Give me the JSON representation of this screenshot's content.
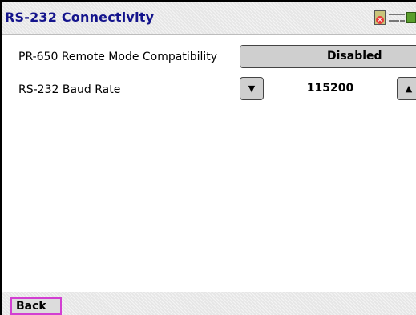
{
  "header": {
    "title": "RS-232 Connectivity",
    "status_icons": [
      "sd-card-error-icon",
      "connection-icon",
      "battery-icon"
    ]
  },
  "settings": [
    {
      "label": "PR-650 Remote Mode Compatibility",
      "value": "Disabled",
      "control": "toggle-button"
    },
    {
      "label": "RS-232 Baud Rate",
      "value": "115200",
      "control": "spinner",
      "down_symbol": "▼",
      "up_symbol": "▲"
    }
  ],
  "footer": {
    "back_label": "Back"
  },
  "colors": {
    "title": "#14148c",
    "focus_border": "#d23fd2",
    "button_fill": "#cfcfcf"
  }
}
